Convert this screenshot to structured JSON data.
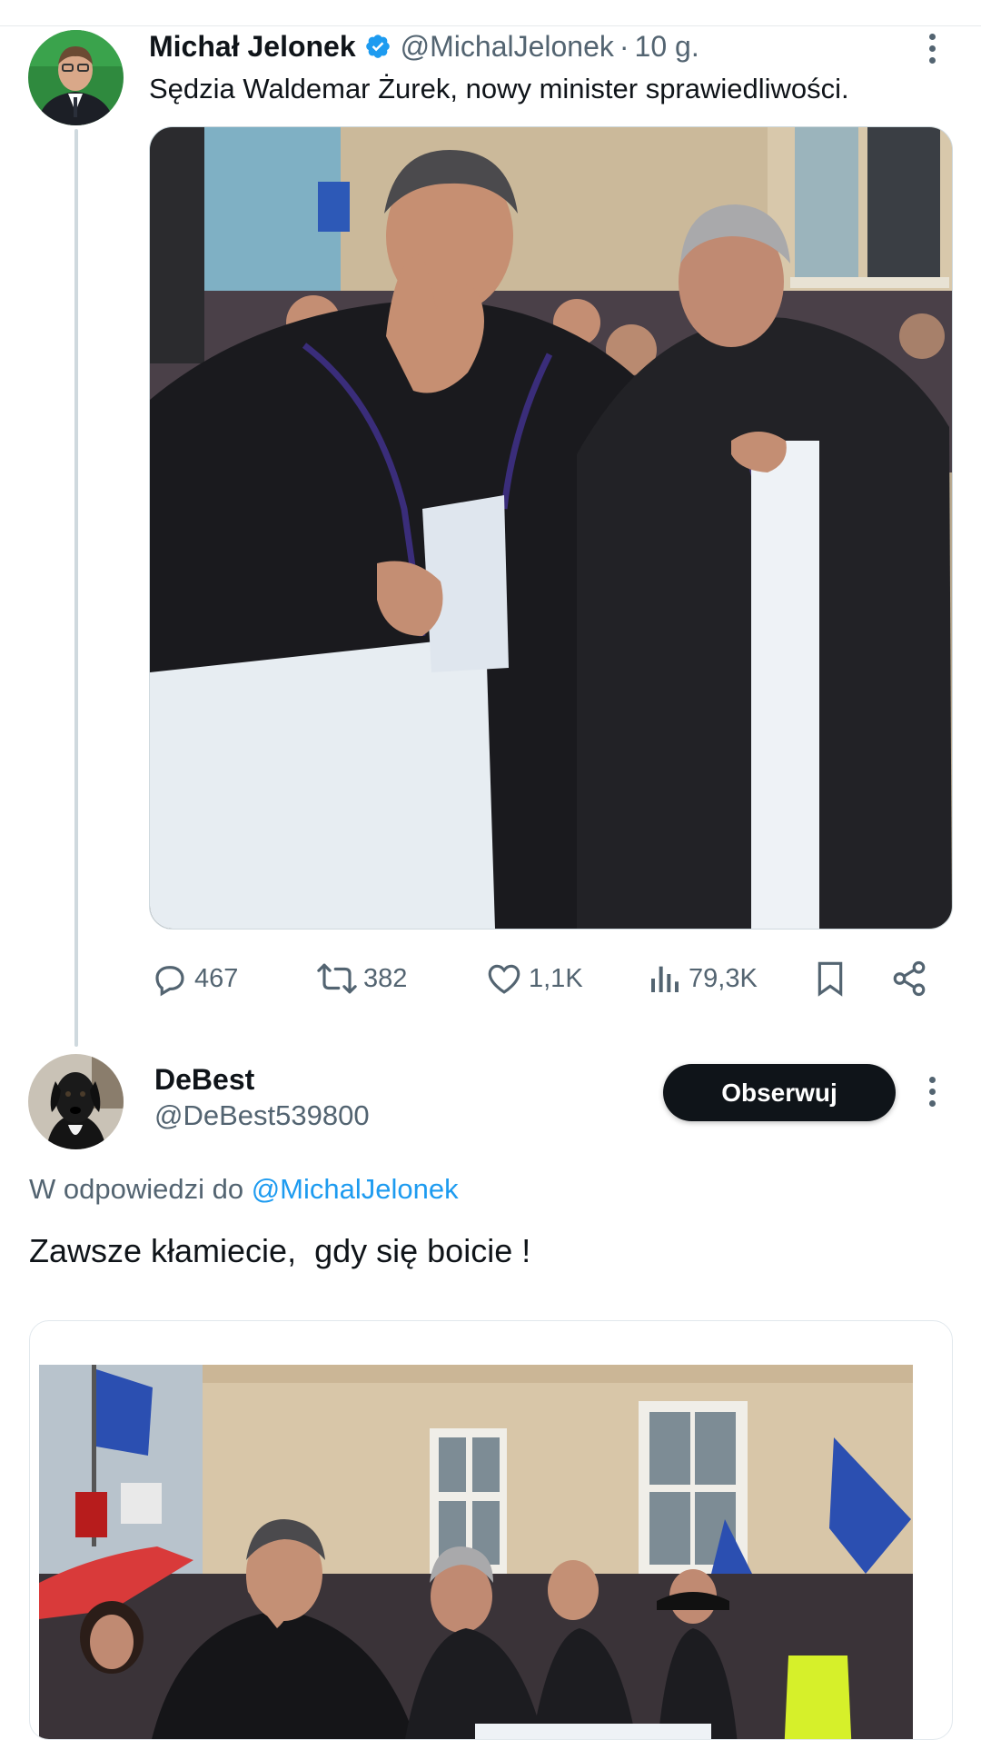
{
  "tweet1": {
    "author_name": "Michał Jelonek",
    "handle": "@MichalJelonek",
    "separator": "·",
    "time": "10 g.",
    "verified_icon": "verified-badge-icon",
    "text": "Sędzia Waldemar Żurek, nowy minister sprawiedliwości.",
    "media_description_icon": "photo",
    "stats": {
      "replies": "467",
      "retweets": "382",
      "likes": "1,1K",
      "views": "79,3K"
    }
  },
  "tweet2": {
    "author_name": "DeBest",
    "handle": "@DeBest539800",
    "follow_label": "Obserwuj",
    "reply_prefix": "W odpowiedzi do ",
    "reply_mention": "@MichalJelonek",
    "text": "Zawsze kłamiecie,  gdy się boicie !"
  },
  "colors": {
    "text": "#0f1419",
    "secondary": "#536471",
    "link": "#1d9bf0",
    "verified": "#1d9bf0",
    "thread_line": "#cfd9de",
    "button_bg": "#0f1419"
  }
}
